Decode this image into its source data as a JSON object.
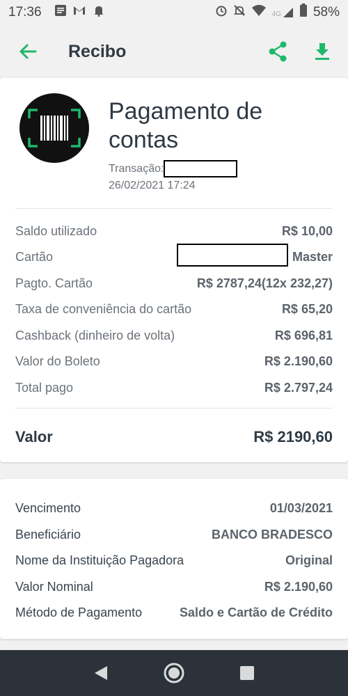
{
  "status_bar": {
    "time": "17:36",
    "network": "4G",
    "battery": "58%"
  },
  "app_bar": {
    "title": "Recibo",
    "icons": [
      "back-arrow-icon",
      "share-icon",
      "download-icon"
    ],
    "accent_color": "#1fb86b"
  },
  "header": {
    "title_line1": "Pagamento de",
    "title_line2": "contas",
    "transaction_label": "Transação:",
    "datetime": "26/02/2021 17:24",
    "logo": "barcode-scan-icon"
  },
  "summary": [
    {
      "label": "Saldo utilizado",
      "value": "R$ 10,00"
    },
    {
      "label": "Cartão",
      "value": "Master"
    },
    {
      "label": "Pagto. Cartão",
      "value": "R$ 2787,24(12x 232,27)"
    },
    {
      "label": "Taxa de conveniência do cartão",
      "value": "R$ 65,20"
    },
    {
      "label": "Cashback (dinheiro de volta)",
      "value": "R$ 696,81"
    },
    {
      "label": "Valor do Boleto",
      "value": "R$ 2.190,60"
    },
    {
      "label": "Total pago",
      "value": "R$ 2.797,24"
    }
  ],
  "total": {
    "label": "Valor",
    "value": "R$ 2190,60"
  },
  "details": [
    {
      "label": "Vencimento",
      "value": "01/03/2021"
    },
    {
      "label": "Beneficiário",
      "value": "BANCO BRADESCO"
    },
    {
      "label": "Nome da Instituição Pagadora",
      "value": "Original"
    },
    {
      "label": "Valor Nominal",
      "value": "R$ 2.190,60"
    },
    {
      "label": "Método de Pagamento",
      "value": "Saldo e Cartão de Crédito"
    }
  ],
  "nav_bar": {
    "icons": [
      "back-triangle-icon",
      "home-circle-icon",
      "recents-square-icon"
    ]
  }
}
